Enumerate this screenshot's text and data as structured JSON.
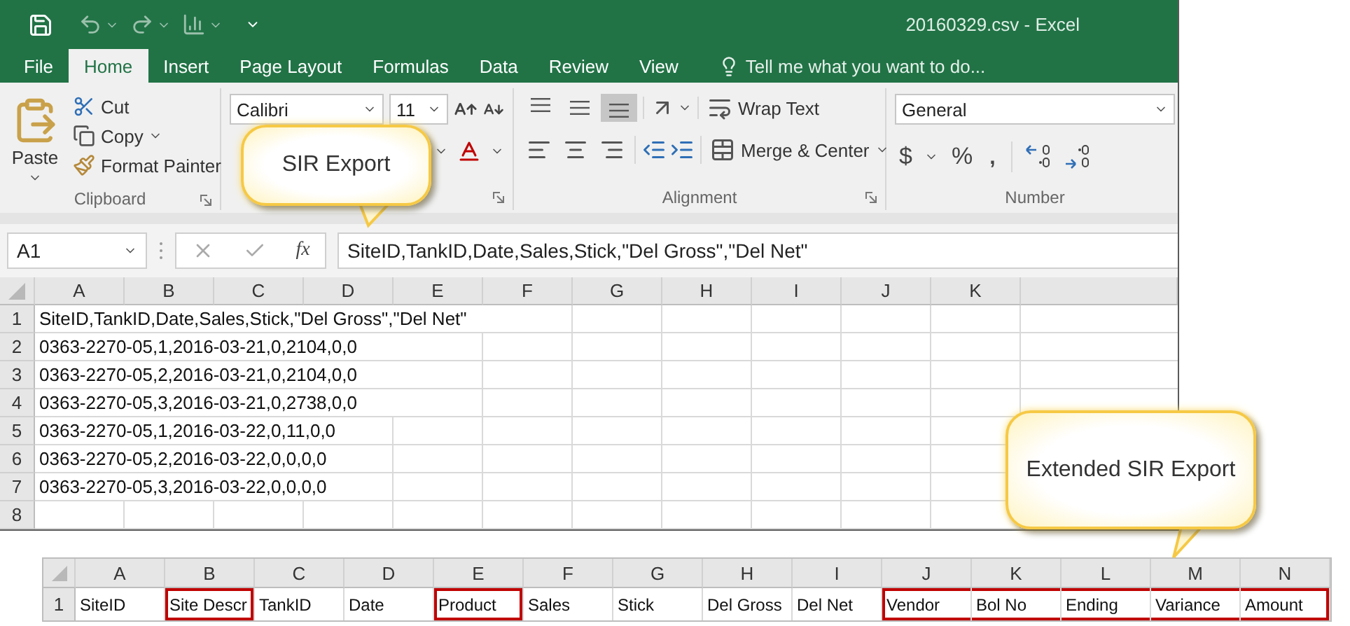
{
  "window": {
    "title": "20160329.csv - Excel"
  },
  "ribbon_tabs": [
    {
      "label": "File",
      "selected": false
    },
    {
      "label": "Home",
      "selected": true
    },
    {
      "label": "Insert",
      "selected": false
    },
    {
      "label": "Page Layout",
      "selected": false
    },
    {
      "label": "Formulas",
      "selected": false
    },
    {
      "label": "Data",
      "selected": false
    },
    {
      "label": "Review",
      "selected": false
    },
    {
      "label": "View",
      "selected": false
    }
  ],
  "tell_me": "Tell me what you want to do...",
  "clipboard": {
    "paste": "Paste",
    "cut": "Cut",
    "copy": "Copy",
    "format_painter": "Format Painter",
    "label": "Clipboard"
  },
  "font": {
    "name": "Calibri",
    "size": "11"
  },
  "alignment": {
    "wrap_text": "Wrap Text",
    "merge": "Merge & Center",
    "label": "Alignment"
  },
  "number": {
    "format": "General",
    "currency": "$",
    "percent": "%",
    "comma": ",",
    "label": "Number"
  },
  "formula_bar": {
    "name_box": "A1",
    "function_symbol": "fx",
    "formula": "SiteID,TankID,Date,Sales,Stick,\"Del Gross\",\"Del Net\""
  },
  "sheet": {
    "columns": [
      "A",
      "B",
      "C",
      "D",
      "E",
      "F",
      "G",
      "H",
      "I",
      "J",
      "K"
    ],
    "rows": [
      {
        "number": "1",
        "text": "SiteID,TankID,Date,Sales,Stick,\"Del Gross\",\"Del Net\""
      },
      {
        "number": "2",
        "text": "0363-2270-05,1,2016-03-21,0,2104,0,0"
      },
      {
        "number": "3",
        "text": "0363-2270-05,2,2016-03-21,0,2104,0,0"
      },
      {
        "number": "4",
        "text": "0363-2270-05,3,2016-03-21,0,2738,0,0"
      },
      {
        "number": "5",
        "text": "0363-2270-05,1,2016-03-22,0,11,0,0"
      },
      {
        "number": "6",
        "text": "0363-2270-05,2,2016-03-22,0,0,0,0"
      },
      {
        "number": "7",
        "text": "0363-2270-05,3,2016-03-22,0,0,0,0"
      },
      {
        "number": "8"
      }
    ]
  },
  "extended_sheet": {
    "row_number": "1",
    "columns": [
      {
        "letter": "A",
        "header": "SiteID",
        "highlighted": false
      },
      {
        "letter": "B",
        "header": "Site Descr",
        "highlighted": true
      },
      {
        "letter": "C",
        "header": "TankID",
        "highlighted": false
      },
      {
        "letter": "D",
        "header": "Date",
        "highlighted": false
      },
      {
        "letter": "E",
        "header": "Product",
        "highlighted": true
      },
      {
        "letter": "F",
        "header": "Sales",
        "highlighted": false
      },
      {
        "letter": "G",
        "header": "Stick",
        "highlighted": false
      },
      {
        "letter": "H",
        "header": "Del Gross",
        "highlighted": false
      },
      {
        "letter": "I",
        "header": "Del Net",
        "highlighted": false
      },
      {
        "letter": "J",
        "header": "Vendor",
        "highlighted": true
      },
      {
        "letter": "K",
        "header": "Bol No",
        "highlighted": true
      },
      {
        "letter": "L",
        "header": "Ending",
        "highlighted": true
      },
      {
        "letter": "M",
        "header": "Variance",
        "highlighted": true
      },
      {
        "letter": "N",
        "header": "Amount",
        "highlighted": true
      }
    ]
  },
  "callouts": [
    {
      "text": "SIR Export"
    },
    {
      "text": "Extended SIR Export"
    }
  ]
}
